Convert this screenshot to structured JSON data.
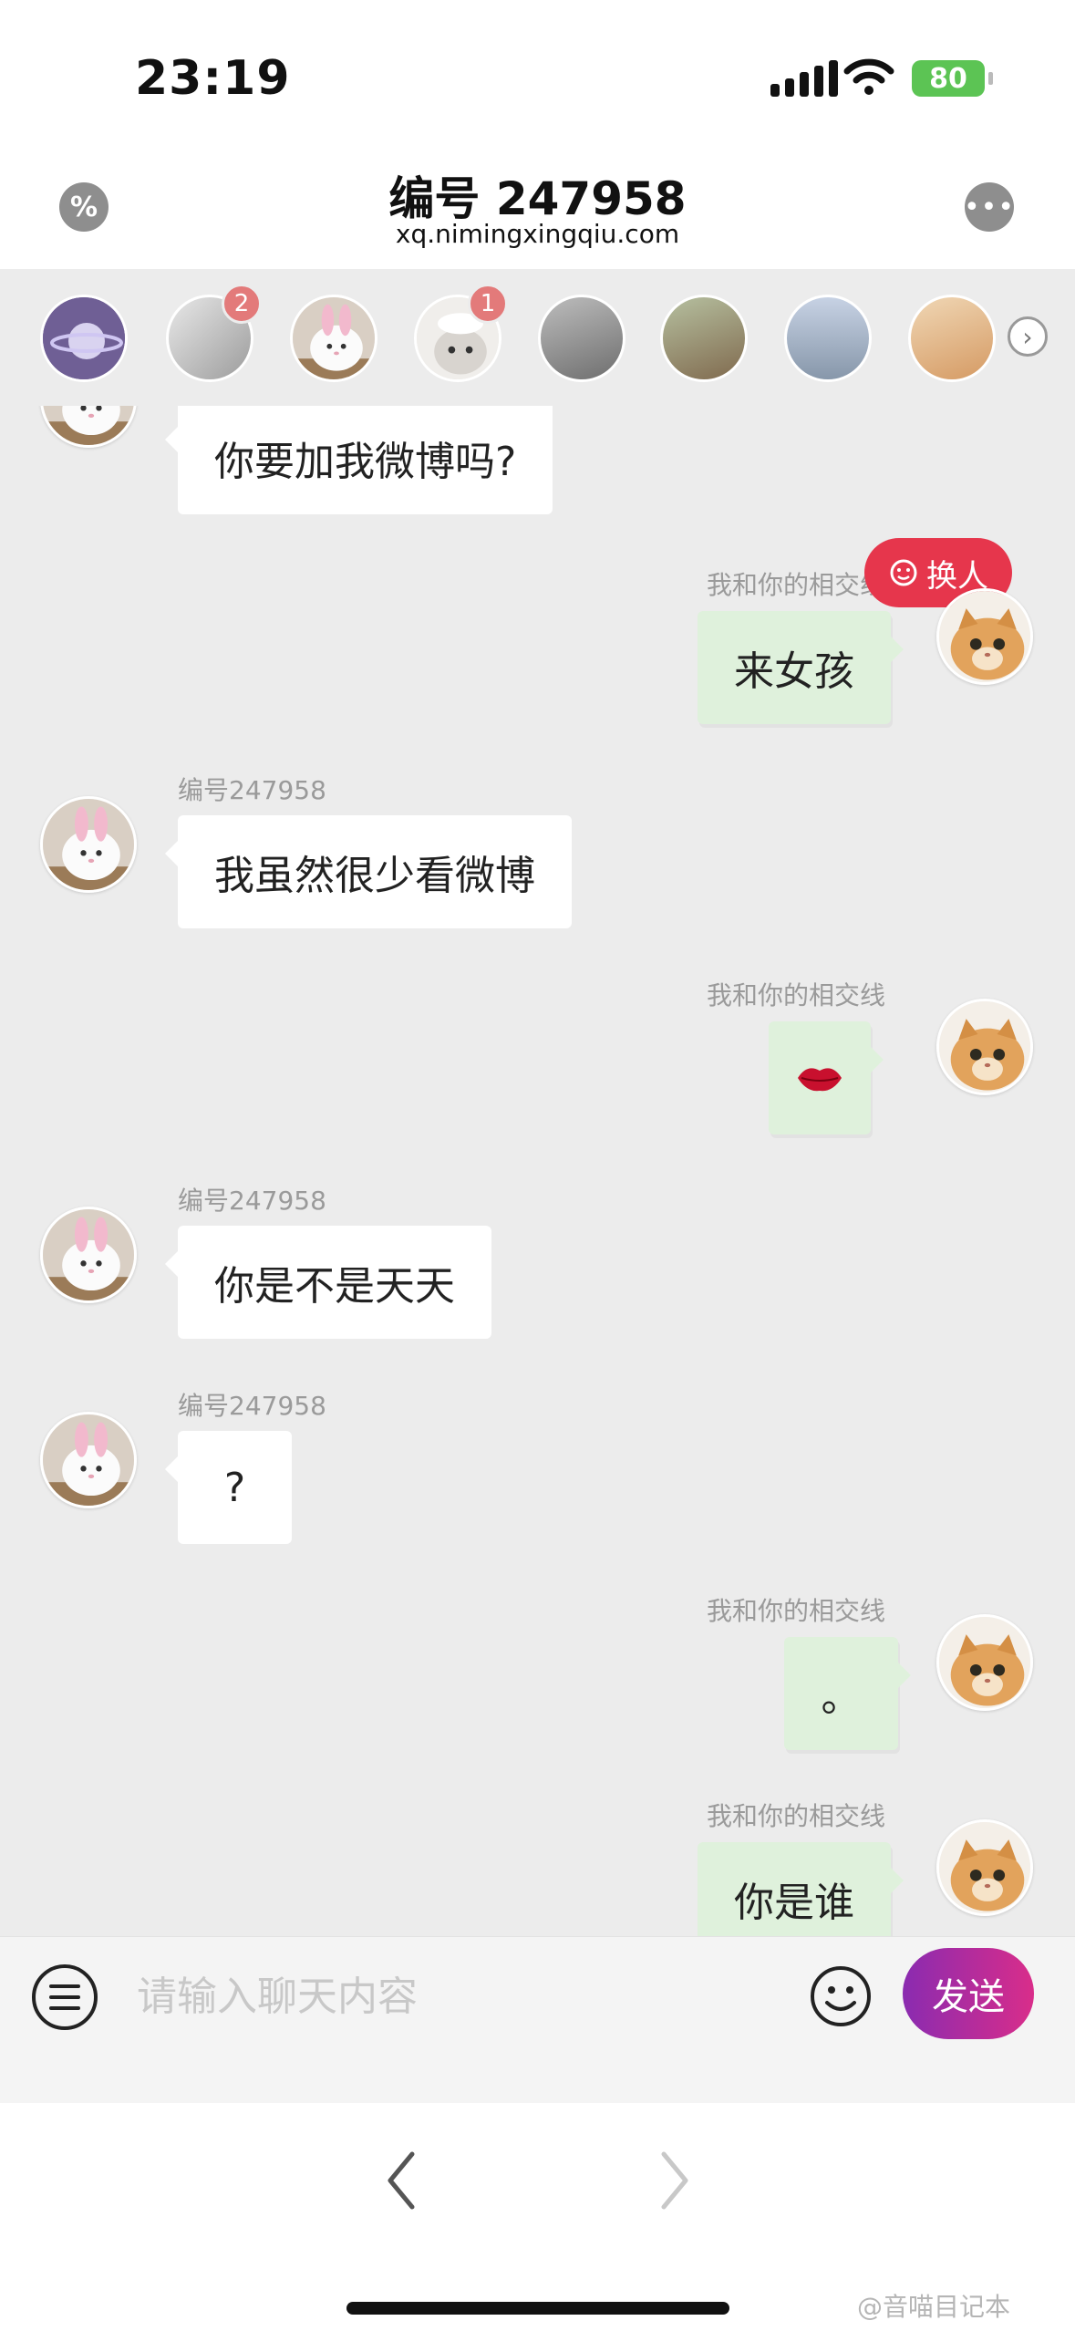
{
  "status_bar": {
    "time": "23:19",
    "battery": "80"
  },
  "header": {
    "left_icon": "%",
    "title": "编号 247958",
    "subtitle": "xq.nimingxingqiu.com",
    "more_icon": "•••"
  },
  "avatar_strip": {
    "badges": [
      "2",
      "1"
    ],
    "more_icon": "›"
  },
  "switch_button": {
    "label": "换人"
  },
  "messages": [
    {
      "side": "in",
      "sender": "",
      "text": "你要加我微博吗?"
    },
    {
      "side": "out",
      "sender": "我和你的相交线",
      "text": "来女孩"
    },
    {
      "side": "in",
      "sender": "编号247958",
      "text": "我虽然很少看微博"
    },
    {
      "side": "out",
      "sender": "我和你的相交线",
      "text": "💋"
    },
    {
      "side": "in",
      "sender": "编号247958",
      "text": "你是不是天天"
    },
    {
      "side": "in",
      "sender": "编号247958",
      "text": "?"
    },
    {
      "side": "out",
      "sender": "我和你的相交线",
      "text": "。"
    },
    {
      "side": "out",
      "sender": "我和你的相交线",
      "text": "你是谁"
    }
  ],
  "input": {
    "placeholder": "请输入聊天内容",
    "send_label": "发送"
  },
  "watermark": "@音喵目记本",
  "colors": {
    "switch_button": "#e6364c",
    "send_gradient_start": "#8a2bb0",
    "send_gradient_end": "#d92d8a",
    "outgoing_bubble": "#dff1dc",
    "incoming_bubble": "#ffffff",
    "chat_background": "#ececec",
    "battery": "#5cc454"
  }
}
